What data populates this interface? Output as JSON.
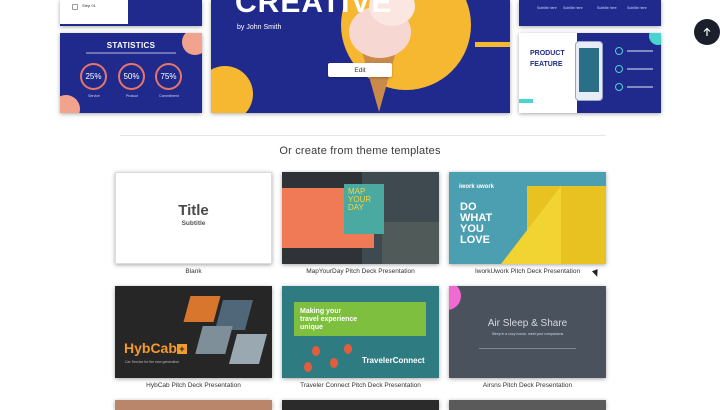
{
  "featured": {
    "top_left_checkbox_text": "Step 01",
    "stats": {
      "title": "STATISTICS",
      "items": [
        {
          "value": "25%",
          "label": "Service"
        },
        {
          "value": "50%",
          "label": "Product"
        },
        {
          "value": "75%",
          "label": "Commitment"
        }
      ]
    },
    "main": {
      "title": "CREATIVE",
      "author": "by John Smith",
      "edit_label": "Edit"
    },
    "top_right_items": [
      "Subtitle here",
      "Subtitle here",
      "Subtitle here",
      "Subtitle here"
    ],
    "product": {
      "title_line1": "PRODUCT",
      "title_line2": "FEATURE"
    }
  },
  "scroll_top_icon": "arrow-up-icon",
  "section_heading": "Or create from theme templates",
  "templates": [
    {
      "name": "Blank",
      "preview_title": "Title",
      "preview_subtitle": "Subtitle"
    },
    {
      "name": "MapYourDay Pitch Deck Presentation",
      "preview_text_l1": "MAP",
      "preview_text_l2": "YOUR",
      "preview_text_l3": "DAY"
    },
    {
      "name": "IworkUwork Pitch Deck Presentation",
      "preview_logo": "iwork uwork",
      "preview_text_l1": "DO",
      "preview_text_l2": "WHAT",
      "preview_text_l3": "YOU",
      "preview_text_l4": "LOVE"
    },
    {
      "name": "HybCab Pitch Deck Presentation",
      "preview_title": "HybCab",
      "preview_plus": "+",
      "preview_small": "Car Service for the new generation"
    },
    {
      "name": "Traveler Connect Pitch Deck Presentation",
      "preview_text_l1": "Making your",
      "preview_text_l2": "travel experience",
      "preview_text_l3": "unique",
      "preview_brand": "TravelerConnect"
    },
    {
      "name": "Airsns Pitch Deck Presentation",
      "preview_title": "Air Sleep & Share",
      "preview_small": "Sleep in a cozy house, meet your companions"
    }
  ],
  "colors": {
    "featured_blue": "#1f2a8c",
    "accent_yellow": "#f6b731",
    "scroll_button": "#1a1f2b"
  }
}
